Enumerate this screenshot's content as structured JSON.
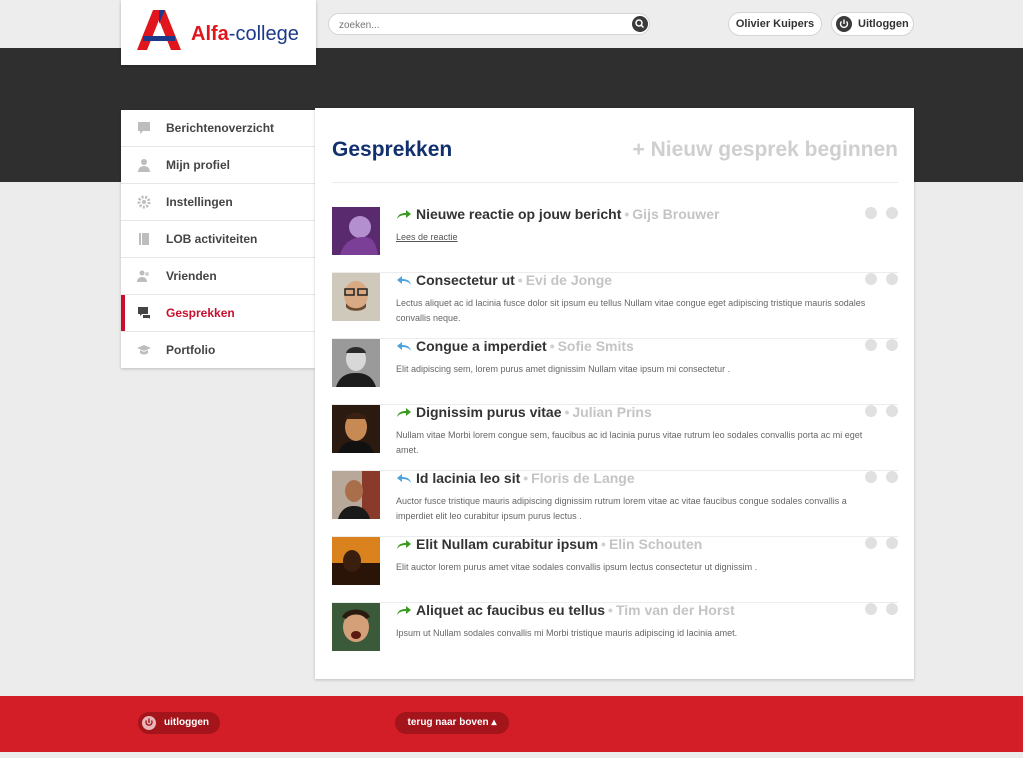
{
  "brand": {
    "logo_bold": "Alfa",
    "logo_rest": "-college",
    "color_red": "#e0161c",
    "color_blue": "#1d3a8a"
  },
  "header": {
    "search_placeholder": "zoeken...",
    "user_name": "Olivier Kuipers",
    "logout_label": "Uitloggen"
  },
  "sidebar": {
    "items": [
      {
        "label": "Berichtenoverzicht",
        "icon": "speech-bubble-icon"
      },
      {
        "label": "Mijn profiel",
        "icon": "user-icon"
      },
      {
        "label": "Instellingen",
        "icon": "gear-icon"
      },
      {
        "label": "LOB activiteiten",
        "icon": "book-icon"
      },
      {
        "label": "Vrienden",
        "icon": "friends-icon"
      },
      {
        "label": "Gesprekken",
        "icon": "chat-bubbles-icon",
        "active": true
      },
      {
        "label": "Portfolio",
        "icon": "graduation-cap-icon"
      }
    ]
  },
  "main": {
    "title": "Gesprekken",
    "new_conversation": "+ Nieuw gesprek beginnen",
    "messages": [
      {
        "subject": "Nieuwe reactie op jouw bericht",
        "from": "Gijs Brouwer",
        "body": "Lees de reactie",
        "direction": "outgoing"
      },
      {
        "subject": "Consectetur ut",
        "from": "Evi de Jonge",
        "body": "Lectus aliquet ac id lacinia fusce dolor sit ipsum eu tellus Nullam vitae congue eget adipiscing tristique mauris sodales convallis neque.",
        "direction": "reply"
      },
      {
        "subject": "Congue a imperdiet",
        "from": "Sofie Smits",
        "body": "Elit adipiscing sem, lorem purus amet dignissim Nullam vitae ipsum mi consectetur .",
        "direction": "reply"
      },
      {
        "subject": "Dignissim purus vitae",
        "from": "Julian Prins",
        "body": "Nullam vitae Morbi lorem congue sem, faucibus ac id lacinia purus vitae rutrum leo sodales convallis porta ac mi eget amet.",
        "direction": "outgoing"
      },
      {
        "subject": "Id lacinia leo sit",
        "from": "Floris de Lange",
        "body": "Auctor fusce tristique mauris adipiscing dignissim rutrum lorem vitae ac vitae faucibus congue sodales convallis a imperdiet elit leo curabitur ipsum purus lectus .",
        "direction": "reply"
      },
      {
        "subject": "Elit Nullam curabitur ipsum",
        "from": "Elin Schouten",
        "body": "Elit auctor lorem purus amet vitae sodales convallis ipsum lectus consectetur ut dignissim .",
        "direction": "outgoing"
      },
      {
        "subject": "Aliquet ac faucibus eu tellus",
        "from": "Tim van der Horst",
        "body": "Ipsum ut Nullam sodales convallis mi Morbi tristique mauris adipiscing id lacinia amet.",
        "direction": "outgoing"
      }
    ]
  },
  "footer": {
    "logout_label": "uitloggen",
    "back_to_top": "terug naar boven ▴"
  }
}
